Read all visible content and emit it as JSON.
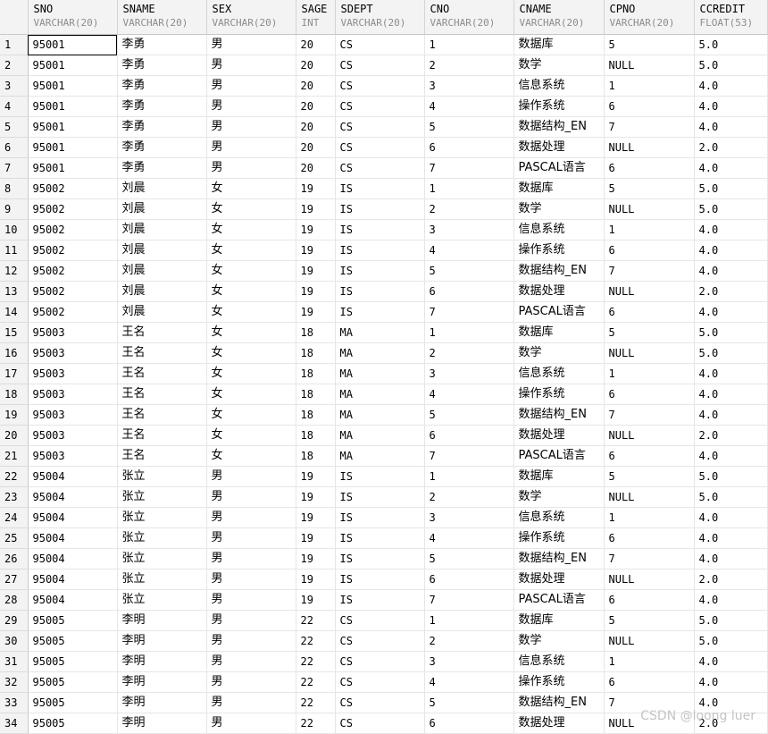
{
  "columns": [
    {
      "name": "SNO",
      "type": "VARCHAR(20)"
    },
    {
      "name": "SNAME",
      "type": "VARCHAR(20)"
    },
    {
      "name": "SEX",
      "type": "VARCHAR(20)"
    },
    {
      "name": "SAGE",
      "type": "INT"
    },
    {
      "name": "SDEPT",
      "type": "VARCHAR(20)"
    },
    {
      "name": "CNO",
      "type": "VARCHAR(20)"
    },
    {
      "name": "CNAME",
      "type": "VARCHAR(20)"
    },
    {
      "name": "CPNO",
      "type": "VARCHAR(20)"
    },
    {
      "name": "CCREDIT",
      "type": "FLOAT(53)"
    }
  ],
  "rows": [
    [
      "1",
      "95001",
      "李勇",
      "男",
      "20",
      "CS",
      "1",
      "数据库",
      "5",
      "5.0"
    ],
    [
      "2",
      "95001",
      "李勇",
      "男",
      "20",
      "CS",
      "2",
      "数学",
      "NULL",
      "5.0"
    ],
    [
      "3",
      "95001",
      "李勇",
      "男",
      "20",
      "CS",
      "3",
      "信息系统",
      "1",
      "4.0"
    ],
    [
      "4",
      "95001",
      "李勇",
      "男",
      "20",
      "CS",
      "4",
      "操作系统",
      "6",
      "4.0"
    ],
    [
      "5",
      "95001",
      "李勇",
      "男",
      "20",
      "CS",
      "5",
      "数据结构_EN",
      "7",
      "4.0"
    ],
    [
      "6",
      "95001",
      "李勇",
      "男",
      "20",
      "CS",
      "6",
      "数据处理",
      "NULL",
      "2.0"
    ],
    [
      "7",
      "95001",
      "李勇",
      "男",
      "20",
      "CS",
      "7",
      "PASCAL语言",
      "6",
      "4.0"
    ],
    [
      "8",
      "95002",
      "刘晨",
      "女",
      "19",
      "IS",
      "1",
      "数据库",
      "5",
      "5.0"
    ],
    [
      "9",
      "95002",
      "刘晨",
      "女",
      "19",
      "IS",
      "2",
      "数学",
      "NULL",
      "5.0"
    ],
    [
      "10",
      "95002",
      "刘晨",
      "女",
      "19",
      "IS",
      "3",
      "信息系统",
      "1",
      "4.0"
    ],
    [
      "11",
      "95002",
      "刘晨",
      "女",
      "19",
      "IS",
      "4",
      "操作系统",
      "6",
      "4.0"
    ],
    [
      "12",
      "95002",
      "刘晨",
      "女",
      "19",
      "IS",
      "5",
      "数据结构_EN",
      "7",
      "4.0"
    ],
    [
      "13",
      "95002",
      "刘晨",
      "女",
      "19",
      "IS",
      "6",
      "数据处理",
      "NULL",
      "2.0"
    ],
    [
      "14",
      "95002",
      "刘晨",
      "女",
      "19",
      "IS",
      "7",
      "PASCAL语言",
      "6",
      "4.0"
    ],
    [
      "15",
      "95003",
      "王名",
      "女",
      "18",
      "MA",
      "1",
      "数据库",
      "5",
      "5.0"
    ],
    [
      "16",
      "95003",
      "王名",
      "女",
      "18",
      "MA",
      "2",
      "数学",
      "NULL",
      "5.0"
    ],
    [
      "17",
      "95003",
      "王名",
      "女",
      "18",
      "MA",
      "3",
      "信息系统",
      "1",
      "4.0"
    ],
    [
      "18",
      "95003",
      "王名",
      "女",
      "18",
      "MA",
      "4",
      "操作系统",
      "6",
      "4.0"
    ],
    [
      "19",
      "95003",
      "王名",
      "女",
      "18",
      "MA",
      "5",
      "数据结构_EN",
      "7",
      "4.0"
    ],
    [
      "20",
      "95003",
      "王名",
      "女",
      "18",
      "MA",
      "6",
      "数据处理",
      "NULL",
      "2.0"
    ],
    [
      "21",
      "95003",
      "王名",
      "女",
      "18",
      "MA",
      "7",
      "PASCAL语言",
      "6",
      "4.0"
    ],
    [
      "22",
      "95004",
      "张立",
      "男",
      "19",
      "IS",
      "1",
      "数据库",
      "5",
      "5.0"
    ],
    [
      "23",
      "95004",
      "张立",
      "男",
      "19",
      "IS",
      "2",
      "数学",
      "NULL",
      "5.0"
    ],
    [
      "24",
      "95004",
      "张立",
      "男",
      "19",
      "IS",
      "3",
      "信息系统",
      "1",
      "4.0"
    ],
    [
      "25",
      "95004",
      "张立",
      "男",
      "19",
      "IS",
      "4",
      "操作系统",
      "6",
      "4.0"
    ],
    [
      "26",
      "95004",
      "张立",
      "男",
      "19",
      "IS",
      "5",
      "数据结构_EN",
      "7",
      "4.0"
    ],
    [
      "27",
      "95004",
      "张立",
      "男",
      "19",
      "IS",
      "6",
      "数据处理",
      "NULL",
      "2.0"
    ],
    [
      "28",
      "95004",
      "张立",
      "男",
      "19",
      "IS",
      "7",
      "PASCAL语言",
      "6",
      "4.0"
    ],
    [
      "29",
      "95005",
      "李明",
      "男",
      "22",
      "CS",
      "1",
      "数据库",
      "5",
      "5.0"
    ],
    [
      "30",
      "95005",
      "李明",
      "男",
      "22",
      "CS",
      "2",
      "数学",
      "NULL",
      "5.0"
    ],
    [
      "31",
      "95005",
      "李明",
      "男",
      "22",
      "CS",
      "3",
      "信息系统",
      "1",
      "4.0"
    ],
    [
      "32",
      "95005",
      "李明",
      "男",
      "22",
      "CS",
      "4",
      "操作系统",
      "6",
      "4.0"
    ],
    [
      "33",
      "95005",
      "李明",
      "男",
      "22",
      "CS",
      "5",
      "数据结构_EN",
      "7",
      "4.0"
    ],
    [
      "34",
      "95005",
      "李明",
      "男",
      "22",
      "CS",
      "6",
      "数据处理",
      "NULL",
      "2.0"
    ]
  ],
  "watermark": "CSDN @loong luer"
}
